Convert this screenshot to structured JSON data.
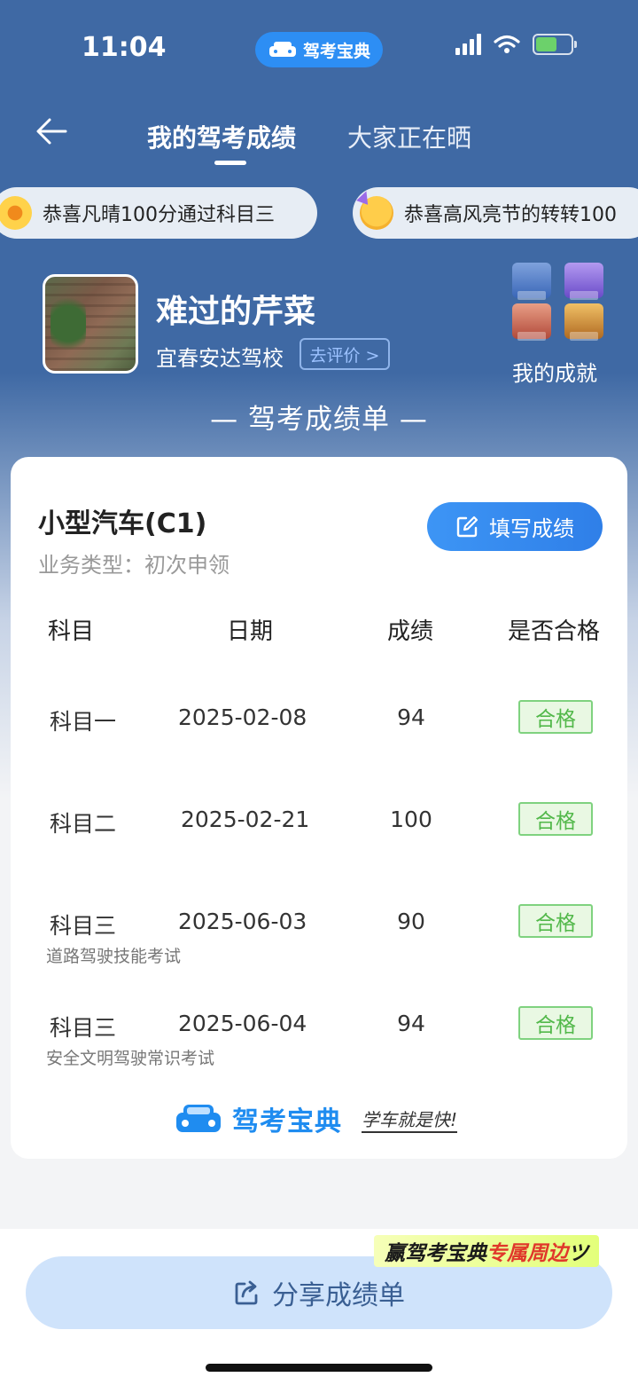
{
  "status_bar": {
    "time": "11:04",
    "app_pill": "驾考宝典"
  },
  "nav": {
    "tab_mine": "我的驾考成绩",
    "tab_others": "大家正在晒"
  },
  "ticker": [
    {
      "text": "恭喜凡晴100分通过科目三",
      "icon": "sunflower-emoji"
    },
    {
      "text": "恭喜高风亮节的转转100",
      "icon": "party-face-emoji"
    }
  ],
  "profile": {
    "name": "难过的芹菜",
    "school": "宜春安达驾校",
    "rate_label": "去评价 >",
    "achievement_label": "我的成就"
  },
  "section_title": "— 驾考成绩单 —",
  "card": {
    "vehicle_type": "小型汽车(C1)",
    "business_type": "业务类型：初次申领",
    "fill_button": "填写成绩",
    "headers": {
      "subject": "科目",
      "date": "日期",
      "score": "成绩",
      "passed": "是否合格"
    },
    "rows": [
      {
        "subject": "科目一",
        "date": "2025-02-08",
        "score": "94",
        "result": "合格",
        "sub": ""
      },
      {
        "subject": "科目二",
        "date": "2025-02-21",
        "score": "100",
        "result": "合格",
        "sub": ""
      },
      {
        "subject": "科目三",
        "date": "2025-06-03",
        "score": "90",
        "result": "合格",
        "sub": "道路驾驶技能考试"
      },
      {
        "subject": "科目三",
        "date": "2025-06-04",
        "score": "94",
        "result": "合格",
        "sub": "安全文明驾驶常识考试"
      }
    ],
    "brand_name": "驾考宝典",
    "brand_slogan": "学车就是快!"
  },
  "promo": {
    "prefix": "赢驾考宝典",
    "highlight": "专属周边",
    "suffix": "ツ"
  },
  "share_button": "分享成绩单",
  "colors": {
    "header_blue": "#3f69a4",
    "accent_blue": "#2f7fe8",
    "pass_green": "#52b84a"
  }
}
